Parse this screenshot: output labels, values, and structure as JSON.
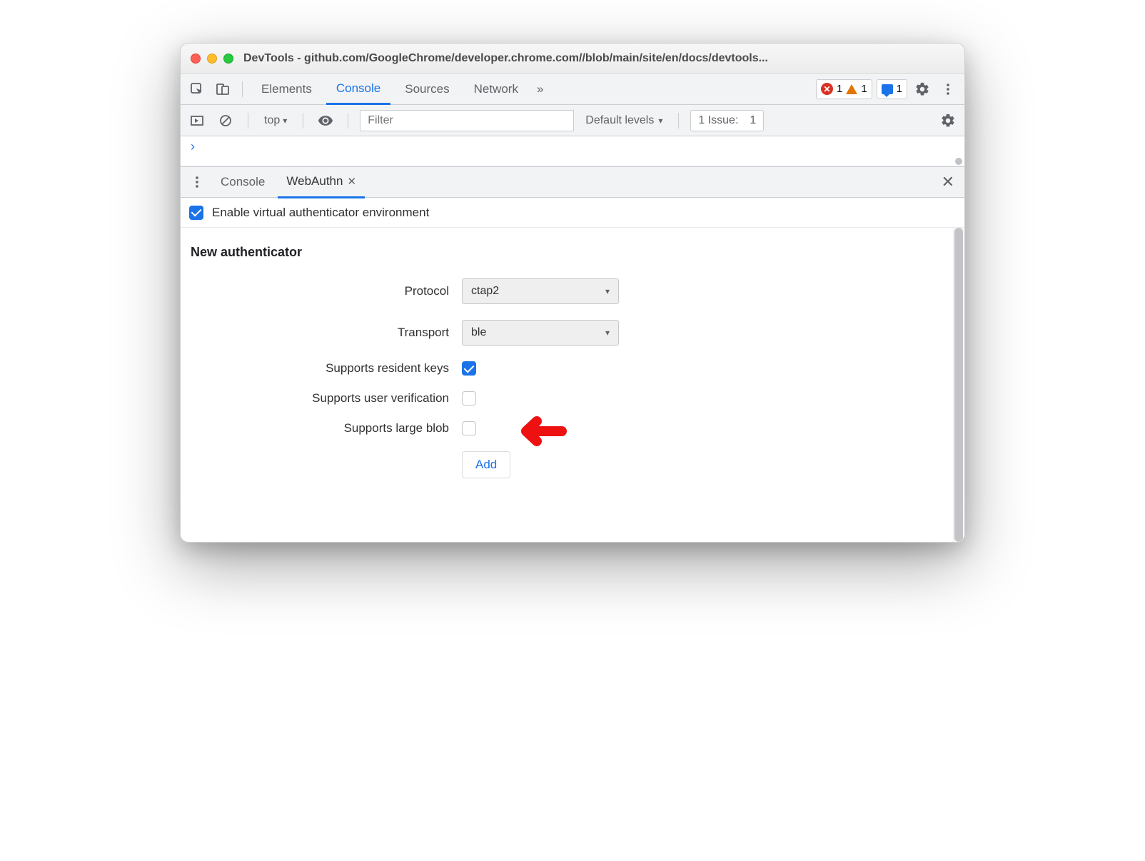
{
  "window": {
    "title": "DevTools - github.com/GoogleChrome/developer.chrome.com//blob/main/site/en/docs/devtools..."
  },
  "toolbar": {
    "tabs": [
      "Elements",
      "Console",
      "Sources",
      "Network"
    ],
    "active_tab": "Console",
    "overflow_glyph": "»",
    "errors_count": "1",
    "warnings_count": "1",
    "messages_count": "1"
  },
  "console_bar": {
    "context": "top",
    "filter_placeholder": "Filter",
    "levels_label": "Default levels",
    "issues_label": "1 Issue:",
    "issues_count": "1"
  },
  "drawer": {
    "tabs": [
      {
        "label": "Console",
        "active": false,
        "closable": false
      },
      {
        "label": "WebAuthn",
        "active": true,
        "closable": true
      }
    ]
  },
  "webauthn": {
    "enable_label": "Enable virtual authenticator environment",
    "enable_checked": true,
    "section_title": "New authenticator",
    "fields": {
      "protocol": {
        "label": "Protocol",
        "value": "ctap2"
      },
      "transport": {
        "label": "Transport",
        "value": "ble"
      },
      "resident_keys": {
        "label": "Supports resident keys",
        "checked": true
      },
      "user_verification": {
        "label": "Supports user verification",
        "checked": false
      },
      "large_blob": {
        "label": "Supports large blob",
        "checked": false
      }
    },
    "add_button": "Add"
  }
}
